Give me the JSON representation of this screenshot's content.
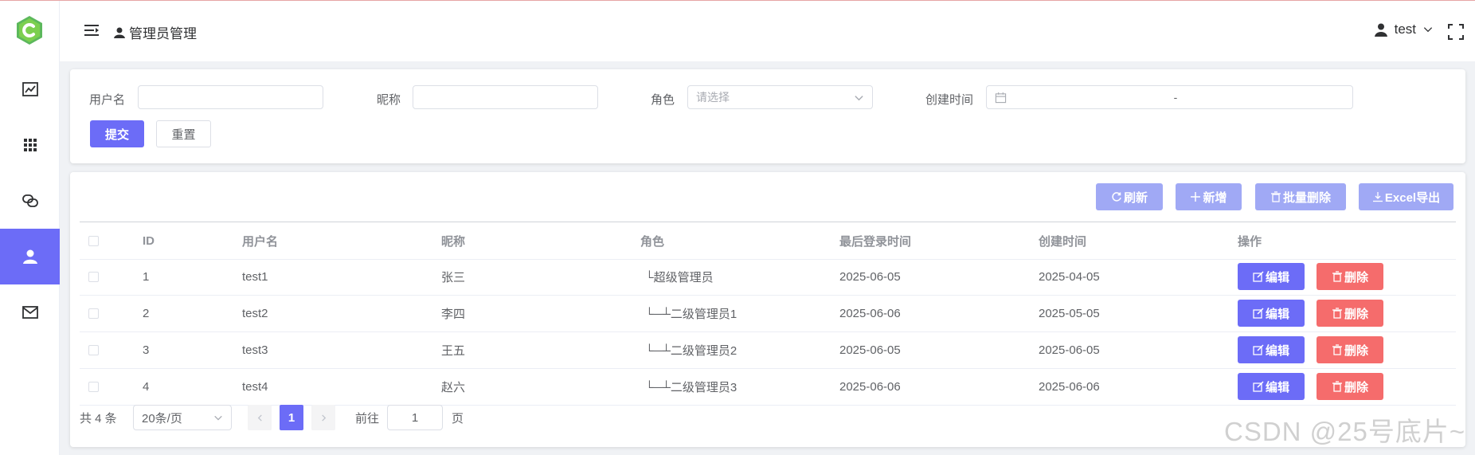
{
  "sidebar": {
    "items": [
      {
        "icon": "line-chart-icon"
      },
      {
        "icon": "grid-icon"
      },
      {
        "icon": "link-icon"
      },
      {
        "icon": "user-icon",
        "active": true
      },
      {
        "icon": "mail-icon"
      }
    ]
  },
  "header": {
    "breadcrumb": "管理员管理",
    "user": "test"
  },
  "filter": {
    "username_label": "用户名",
    "nickname_label": "昵称",
    "role_label": "角色",
    "role_placeholder": "请选择",
    "created_label": "创建时间",
    "date_separator": "-",
    "submit": "提交",
    "reset": "重置"
  },
  "toolbar": {
    "refresh": "刷新",
    "add": "新增",
    "batch_delete": "批量删除",
    "export": "Excel导出"
  },
  "table": {
    "columns": [
      "ID",
      "用户名",
      "昵称",
      "角色",
      "最后登录时间",
      "创建时间",
      "操作"
    ],
    "rows": [
      {
        "id": "1",
        "username": "test1",
        "nickname": "张三",
        "role": "└超级管理员",
        "last_login": "2025-06-05",
        "created": "2025-04-05"
      },
      {
        "id": "2",
        "username": "test2",
        "nickname": "李四",
        "role": "└─┴二级管理员1",
        "last_login": "2025-06-06",
        "created": "2025-05-05"
      },
      {
        "id": "3",
        "username": "test3",
        "nickname": "王五",
        "role": "└─┴二级管理员2",
        "last_login": "2025-06-05",
        "created": "2025-06-05"
      },
      {
        "id": "4",
        "username": "test4",
        "nickname": "赵六",
        "role": "└─┴二级管理员3",
        "last_login": "2025-06-06",
        "created": "2025-06-06"
      }
    ],
    "edit_label": "编辑",
    "delete_label": "删除"
  },
  "pagination": {
    "total": "共 4 条",
    "page_size": "20条/页",
    "current": "1",
    "goto_label": "前往",
    "goto_value": "1",
    "page_suffix": "页"
  },
  "watermark": "CSDN @25号底片~",
  "colors": {
    "accent": "#6c6cf7",
    "danger": "#f56c6c",
    "toolbar_btn": "#a0a9f5"
  }
}
